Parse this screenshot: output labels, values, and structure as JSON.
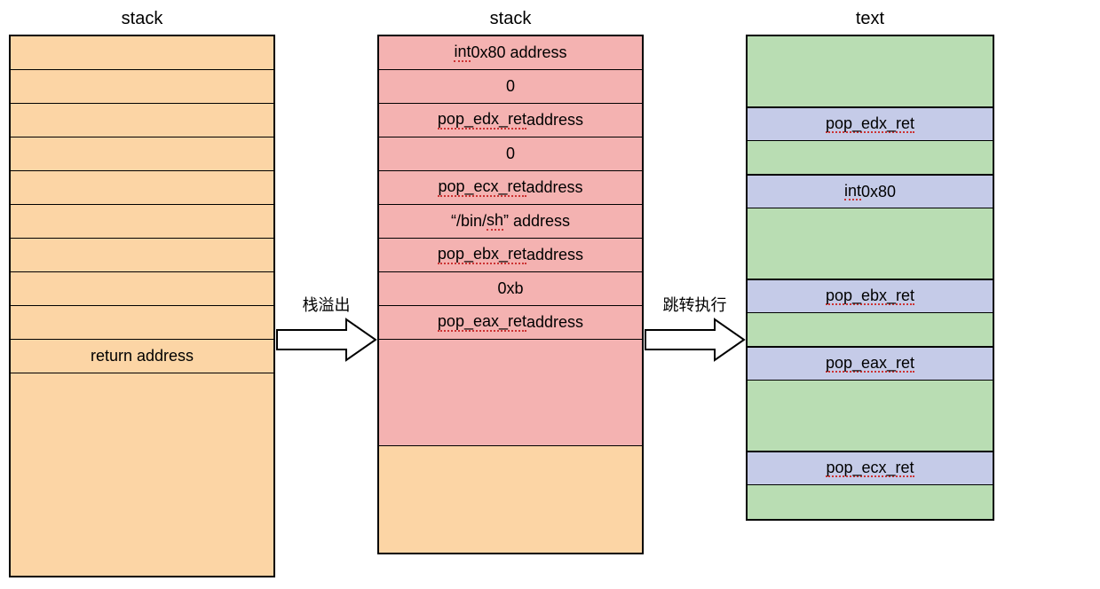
{
  "column1": {
    "title": "stack",
    "rows": [
      {
        "text": "",
        "cls": "orange"
      },
      {
        "text": "",
        "cls": "orange"
      },
      {
        "text": "",
        "cls": "orange"
      },
      {
        "text": "",
        "cls": "orange"
      },
      {
        "text": "",
        "cls": "orange"
      },
      {
        "text": "",
        "cls": "orange"
      },
      {
        "text": "",
        "cls": "orange"
      },
      {
        "text": "",
        "cls": "orange"
      },
      {
        "text": "",
        "cls": "orange"
      },
      {
        "text": "return address",
        "cls": "orange"
      },
      {
        "text": "",
        "cls": "orange filler-tall"
      }
    ]
  },
  "arrow1": {
    "label": "栈溢出"
  },
  "column2": {
    "title": "stack",
    "rows": [
      {
        "html": "<span class='spell'>int</span> 0x80 address",
        "cls": "pink"
      },
      {
        "text": "0",
        "cls": "pink"
      },
      {
        "html": "<span class='spell'>pop_edx_ret</span> address",
        "cls": "pink"
      },
      {
        "text": "0",
        "cls": "pink"
      },
      {
        "html": "<span class='spell'>pop_ecx_ret</span> address",
        "cls": "pink"
      },
      {
        "html": "“/bin/<span class='spell'>sh</span>” address",
        "cls": "pink"
      },
      {
        "html": "<span class='spell'>pop_ebx_ret</span> address",
        "cls": "pink"
      },
      {
        "text": "0xb",
        "cls": "pink"
      },
      {
        "html": "<span class='spell'>pop_eax_ret</span> address",
        "cls": "pink"
      },
      {
        "text": "",
        "cls": "pink filler-med"
      },
      {
        "text": "",
        "cls": "orange filler-med"
      }
    ]
  },
  "arrow2": {
    "label": "跳转执行"
  },
  "column3": {
    "title": "text",
    "rows": [
      {
        "text": "",
        "cls": "green filler-sm"
      },
      {
        "html": "<span class='spell'>pop_edx_ret</span>",
        "cls": "purple"
      },
      {
        "text": "",
        "cls": "green"
      },
      {
        "html": "<span class='spell'>int</span> 0x80",
        "cls": "purple"
      },
      {
        "text": "",
        "cls": "green filler-sm"
      },
      {
        "html": "<span class='spell'>pop_ebx_ret</span>",
        "cls": "purple"
      },
      {
        "text": "",
        "cls": "green"
      },
      {
        "html": "<span class='spell'>pop_eax_ret</span>",
        "cls": "purple"
      },
      {
        "text": "",
        "cls": "green filler-sm"
      },
      {
        "html": "<span class='spell'>pop_ecx_ret</span>",
        "cls": "purple"
      },
      {
        "text": "",
        "cls": "green"
      }
    ]
  }
}
